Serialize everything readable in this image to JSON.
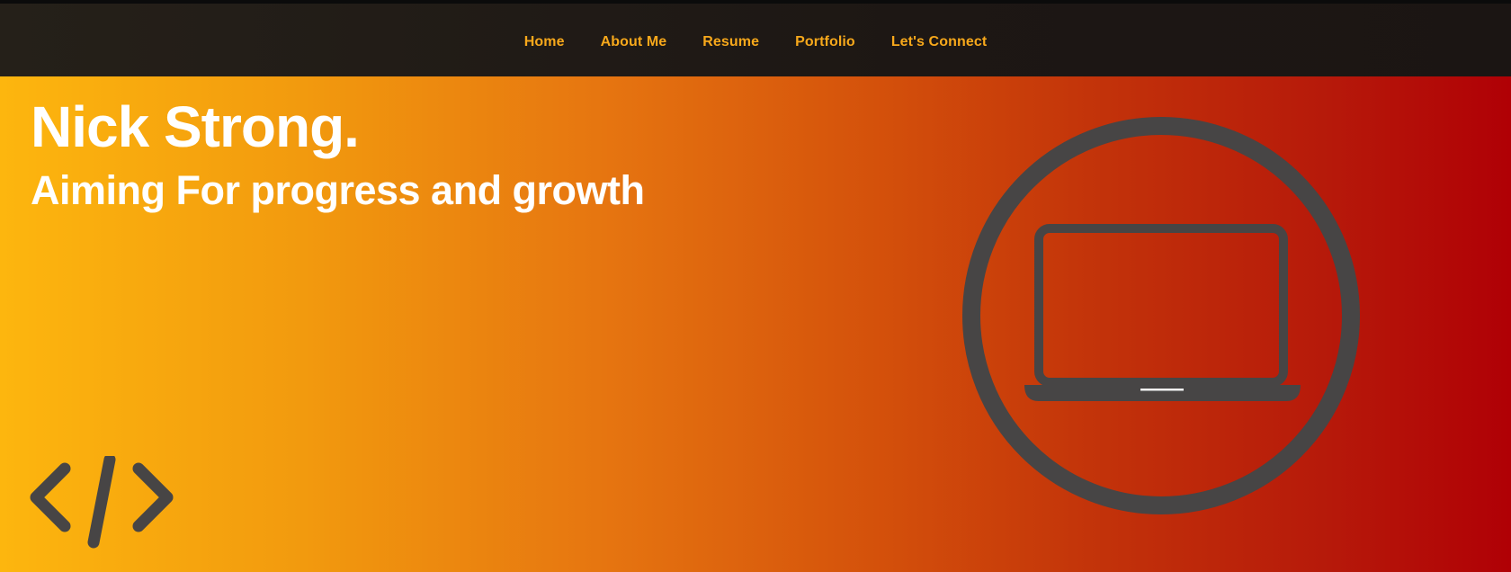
{
  "nav": {
    "items": [
      {
        "label": "Home"
      },
      {
        "label": "About Me"
      },
      {
        "label": "Resume"
      },
      {
        "label": "Portfolio"
      },
      {
        "label": "Let's Connect"
      }
    ]
  },
  "hero": {
    "title": "Nick Strong.",
    "subtitle": "Aiming For progress and growth"
  },
  "icons": {
    "laptop": "laptop-in-circle-icon",
    "code": "code-brackets-icon"
  },
  "colors": {
    "nav_text": "#f7a81b",
    "nav_bg": "#1d1714",
    "gradient_start": "#fdb60e",
    "gradient_end": "#b00005",
    "icon_gray": "#474545",
    "hero_text": "#ffffff"
  }
}
